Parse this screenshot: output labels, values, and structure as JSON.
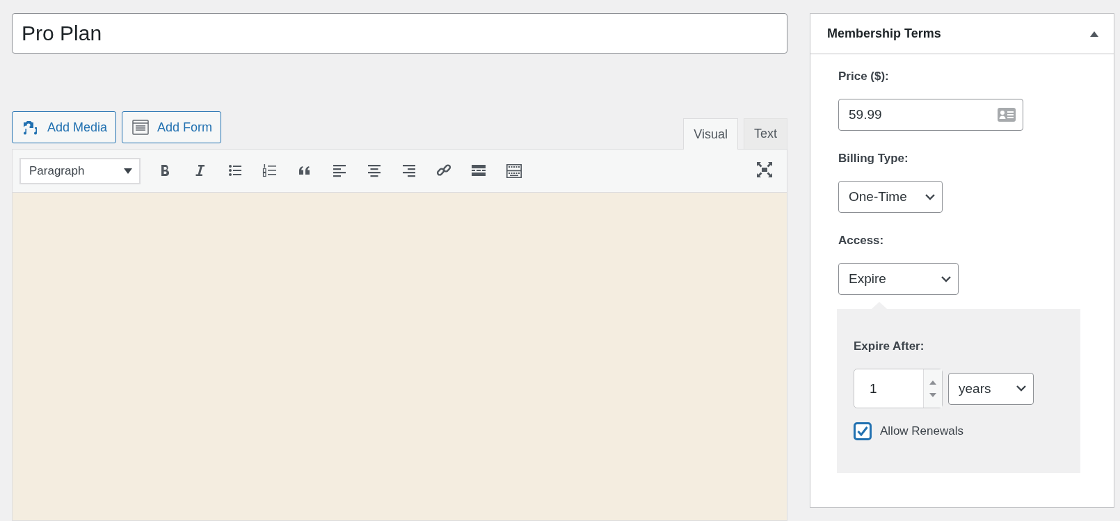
{
  "title_field": {
    "value": "Pro Plan"
  },
  "media_buttons": [
    {
      "label": "Add Media",
      "kind": "media"
    },
    {
      "label": "Add Form",
      "kind": "form"
    }
  ],
  "editor_tabs": [
    {
      "label": "Visual",
      "selected": true
    },
    {
      "label": "Text",
      "selected": false
    }
  ],
  "toolbar": {
    "format_select": "Paragraph"
  },
  "membership_terms": {
    "title": "Membership Terms",
    "price_label": "Price ($):",
    "price_value": "59.99",
    "billing_label": "Billing Type:",
    "billing_value": "One-Time",
    "access_label": "Access:",
    "access_value": "Expire",
    "expire_after_label": "Expire After:",
    "expire_after_value": "1",
    "expire_unit": "years",
    "allow_renewals": {
      "label": "Allow Renewals",
      "checked": true
    }
  }
}
